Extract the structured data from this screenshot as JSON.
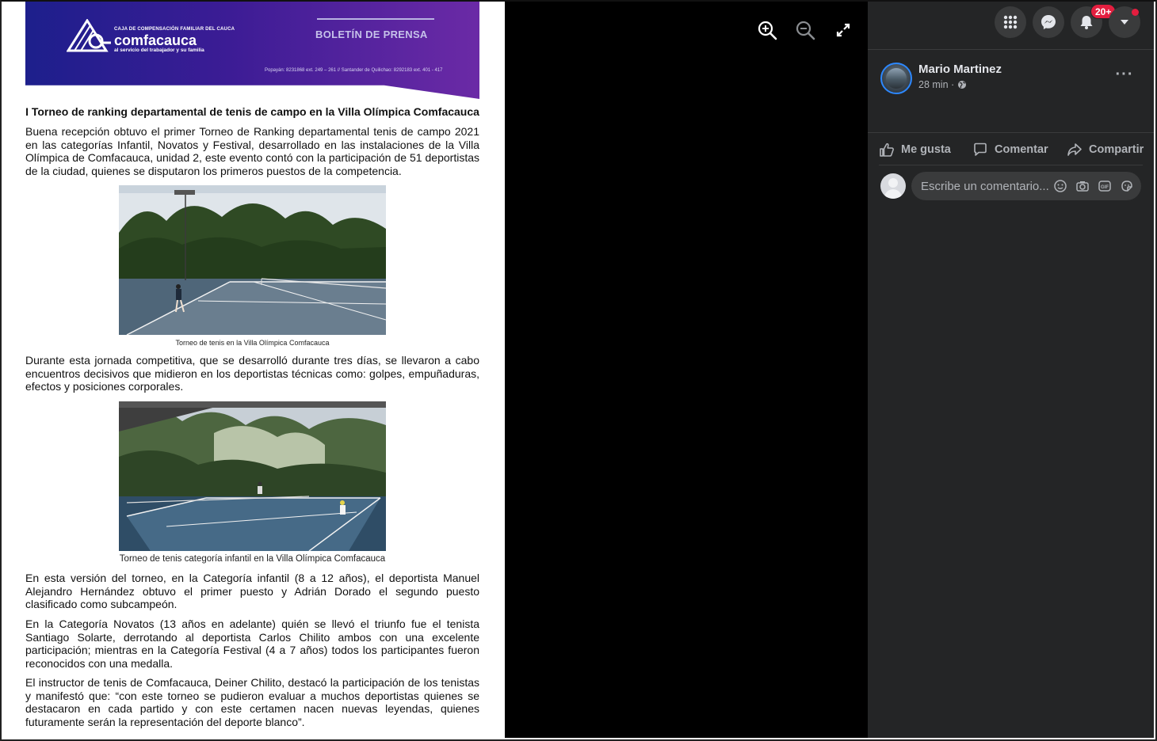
{
  "document": {
    "banner": {
      "org_small": "CAJA DE COMPENSACIÓN FAMILIAR DEL CAUCA",
      "org_name": "comfacauca",
      "tagline": "al servicio del trabajador y su familia",
      "title": "BOLETÍN DE PRENSA",
      "contact": "Popayán: 8231868 ext. 249 – 261 // Santander de Quilichao: 8292183 ext. 401 - 417"
    },
    "title": "I Torneo de ranking departamental de tenis de campo en la Villa Olímpica Comfacauca",
    "paragraphs": [
      "Buena recepción obtuvo el primer Torneo de Ranking departamental tenis de campo 2021 en las categorías Infantil, Novatos y Festival, desarrollado en las instalaciones de la Villa Olímpica de Comfacauca, unidad 2, este evento contó con la participación de 51 deportistas de la ciudad, quienes se disputaron los primeros puestos de la competencia.",
      "Durante esta jornada competitiva, que se desarrolló durante tres días, se llevaron a cabo encuentros decisivos que midieron en los deportistas técnicas como: golpes, empuñaduras,  efectos y posiciones corporales.",
      "En esta versión del torneo, en la Categoría infantil (8 a 12 años), el deportista Manuel Alejandro Hernández obtuvo el primer puesto y Adrián Dorado el segundo puesto clasificado como subcampeón.",
      "En la Categoría Novatos (13 años en adelante) quién se llevó el triunfo fue el tenista Santiago Solarte, derrotando al deportista Carlos Chilito ambos con una excelente participación; mientras en la Categoría Festival (4 a 7 años) todos los participantes fueron reconocidos con una medalla.",
      "El instructor de tenis de Comfacauca, Deiner Chilito, destacó la participación de los tenistas y manifestó que: “con este torneo se pudieron evaluar a muchos deportistas quienes se destacaron en cada partido y con este certamen nacen nuevas leyendas, quienes futuramente serán la representación del deporte blanco”."
    ],
    "captions": [
      "Torneo de tenis en la Villa Olímpica Comfacauca",
      "Torneo de tenis categoría infantil en la Villa Olímpica Comfacauca"
    ]
  },
  "viewer_tools": {
    "zoom_in": "zoom-in-icon",
    "zoom_out": "zoom-out-icon",
    "fullscreen": "fullscreen-icon"
  },
  "top_bar": {
    "notifications_badge": "20+",
    "icons": [
      "menu-grid-icon",
      "messenger-icon",
      "bell-icon",
      "caret-down-icon"
    ]
  },
  "post": {
    "author": "Mario Martinez",
    "time": "28 min ·",
    "more_label": "···"
  },
  "actions": {
    "like": "Me gusta",
    "comment": "Comentar",
    "share": "Compartir"
  },
  "comment": {
    "placeholder": "Escribe un comentario..."
  },
  "colors": {
    "panel_bg": "#242526",
    "button_bg": "#3a3b3c",
    "badge_red": "#e41e3f",
    "banner_start": "#1d1f8c",
    "banner_end": "#6b2aa6",
    "text_secondary": "#b0b3b8"
  }
}
